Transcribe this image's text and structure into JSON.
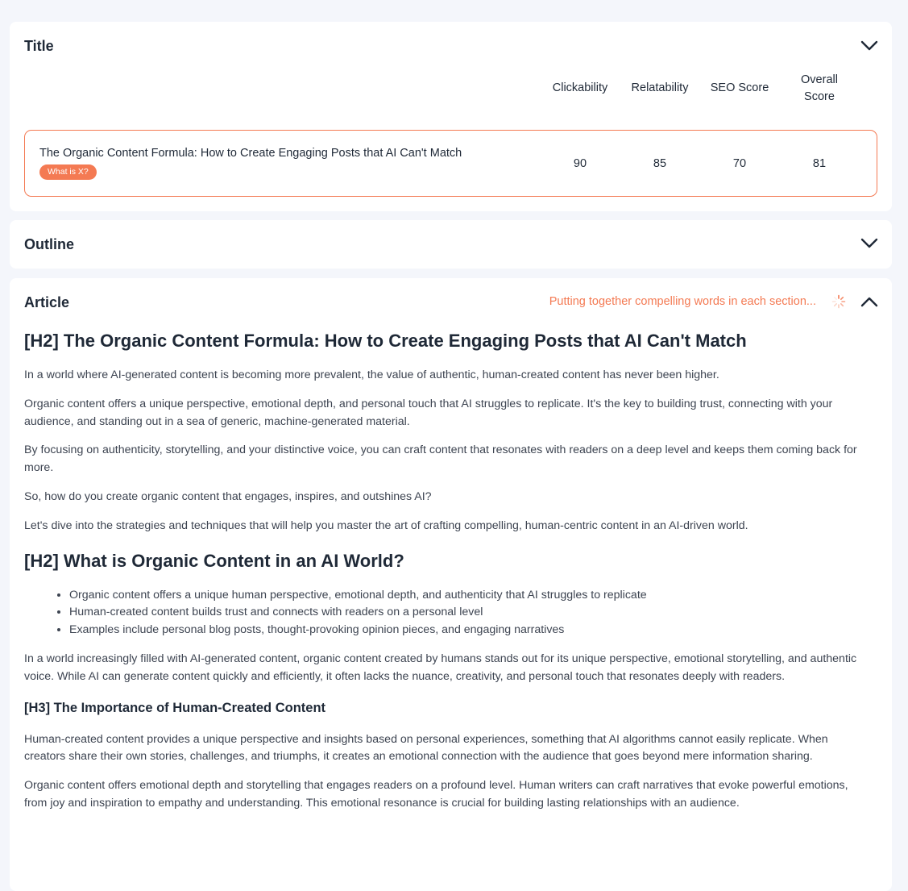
{
  "title_section": {
    "heading": "Title",
    "columns": [
      "Clickability",
      "Relatability",
      "SEO Score",
      "Overall Score"
    ],
    "row": {
      "title": "The Organic Content Formula: How to Create Engaging Posts that AI Can't Match",
      "badge": "What is X?",
      "scores": [
        "90",
        "85",
        "70",
        "81"
      ]
    }
  },
  "outline_section": {
    "heading": "Outline"
  },
  "article_section": {
    "heading": "Article",
    "status": "Putting together compelling words in each section...",
    "h2_1": "[H2] The Organic Content Formula: How to Create Engaging Posts that AI Can't Match",
    "intro": [
      "In a world where AI-generated content is becoming more prevalent, the value of authentic, human-created content has never been higher.",
      "Organic content offers a unique perspective, emotional depth, and personal touch that AI struggles to replicate. It's the key to building trust, connecting with your audience, and standing out in a sea of generic, machine-generated material.",
      "By focusing on authenticity, storytelling, and your distinctive voice, you can craft content that resonates with readers on a deep level and keeps them coming back for more.",
      "So, how do you create organic content that engages, inspires, and outshines AI?",
      "Let's dive into the strategies and techniques that will help you master the art of crafting compelling, human-centric content in an AI-driven world."
    ],
    "h2_2": "[H2] What is Organic Content in an AI World?",
    "bullets": [
      "Organic content offers a unique human perspective, emotional depth, and authenticity that AI struggles to replicate",
      "Human-created content builds trust and connects with readers on a personal level",
      "Examples include personal blog posts, thought-provoking opinion pieces, and engaging narratives"
    ],
    "section2_p": "In a world increasingly filled with AI-generated content, organic content created by humans stands out for its unique perspective, emotional storytelling, and authentic voice. While AI can generate content quickly and efficiently, it often lacks the nuance, creativity, and personal touch that resonates deeply with readers.",
    "h3_1": "[H3] The Importance of Human-Created Content",
    "section3": [
      "Human-created content provides a unique perspective and insights based on personal experiences, something that AI algorithms cannot easily replicate. When creators share their own stories, challenges, and triumphs, it creates an emotional connection with the audience that goes beyond mere information sharing.",
      "Organic content offers emotional depth and storytelling that engages readers on a profound level. Human writers can craft narratives that evoke powerful emotions, from joy and inspiration to empathy and understanding. This emotional resonance is crucial for building lasting relationships with an audience."
    ]
  },
  "colors": {
    "accent": "#f47a53",
    "text": "#1f2937",
    "background": "#f4f6fb"
  },
  "icons": {
    "collapse": "chevron-down-icon",
    "expand": "chevron-up-icon",
    "loading": "spinner-icon"
  }
}
